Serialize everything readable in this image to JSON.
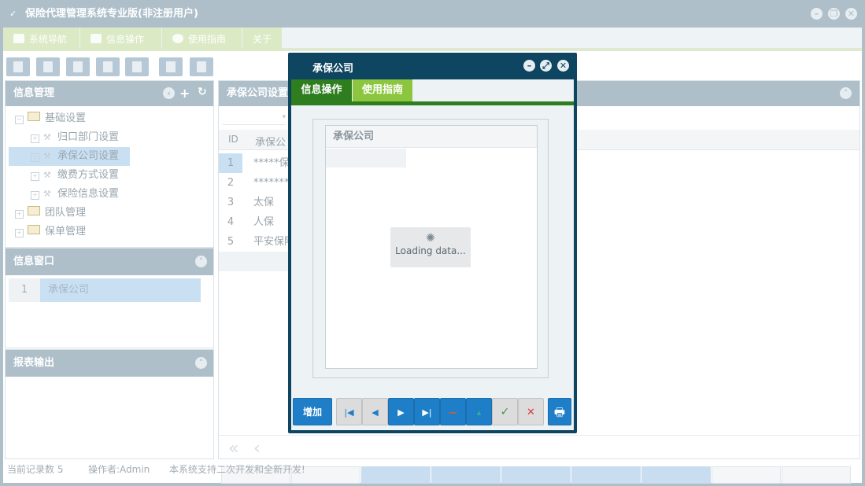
{
  "window": {
    "title": "保险代理管理系统专业版(非注册用户)"
  },
  "main_tabs": [
    {
      "label": "系统导航",
      "icon": "monitor-icon"
    },
    {
      "label": "信息操作",
      "icon": "grid-icon"
    },
    {
      "label": "使用指南",
      "icon": "help-icon"
    },
    {
      "label": "关于",
      "icon": ""
    }
  ],
  "toolbar": {
    "icons": [
      "search-icon",
      "list-icon",
      "document-icon",
      "user-icon",
      "screen-icon",
      "export-icon",
      "print-icon"
    ]
  },
  "info_panel": {
    "title": "信息管理",
    "tree": [
      {
        "label": "基础设置",
        "level": 0,
        "type": "folder"
      },
      {
        "label": "归口部门设置",
        "level": 1,
        "type": "item"
      },
      {
        "label": "承保公司设置",
        "level": 1,
        "type": "item",
        "selected": true
      },
      {
        "label": "缴费方式设置",
        "level": 1,
        "type": "item"
      },
      {
        "label": "保险信息设置",
        "level": 1,
        "type": "item"
      },
      {
        "label": "团队管理",
        "level": 0,
        "type": "folder"
      },
      {
        "label": "保单管理",
        "level": 0,
        "type": "folder"
      }
    ]
  },
  "window_panel": {
    "title": "信息窗口",
    "rows": [
      {
        "num": "1",
        "label": "承保公司"
      }
    ]
  },
  "report_panel": {
    "title": "报表输出"
  },
  "content": {
    "title": "承保公司设置",
    "columns": [
      "ID",
      "承保公"
    ],
    "rows": [
      {
        "id": "1",
        "name": "*****保"
      },
      {
        "id": "2",
        "name": "*******"
      },
      {
        "id": "3",
        "name": "太保"
      },
      {
        "id": "4",
        "name": "人保"
      },
      {
        "id": "5",
        "name": "平安保险"
      }
    ]
  },
  "dialog": {
    "title": "承保公司",
    "tabs": [
      "信息操作",
      "使用指南"
    ],
    "grid_header": "承保公司",
    "loading_text": "Loading data...",
    "add_button": "增加",
    "colors": {
      "frame": "#0e4560",
      "tab_active": "#2e7d1e",
      "tab_secondary": "#8cc63f",
      "button_blue": "#1e7ec8"
    }
  },
  "status_bar": {
    "records": "当前记录数 5",
    "operator": "操作者:Admin",
    "notice": "本系统支持二次开发和全新开发!"
  }
}
